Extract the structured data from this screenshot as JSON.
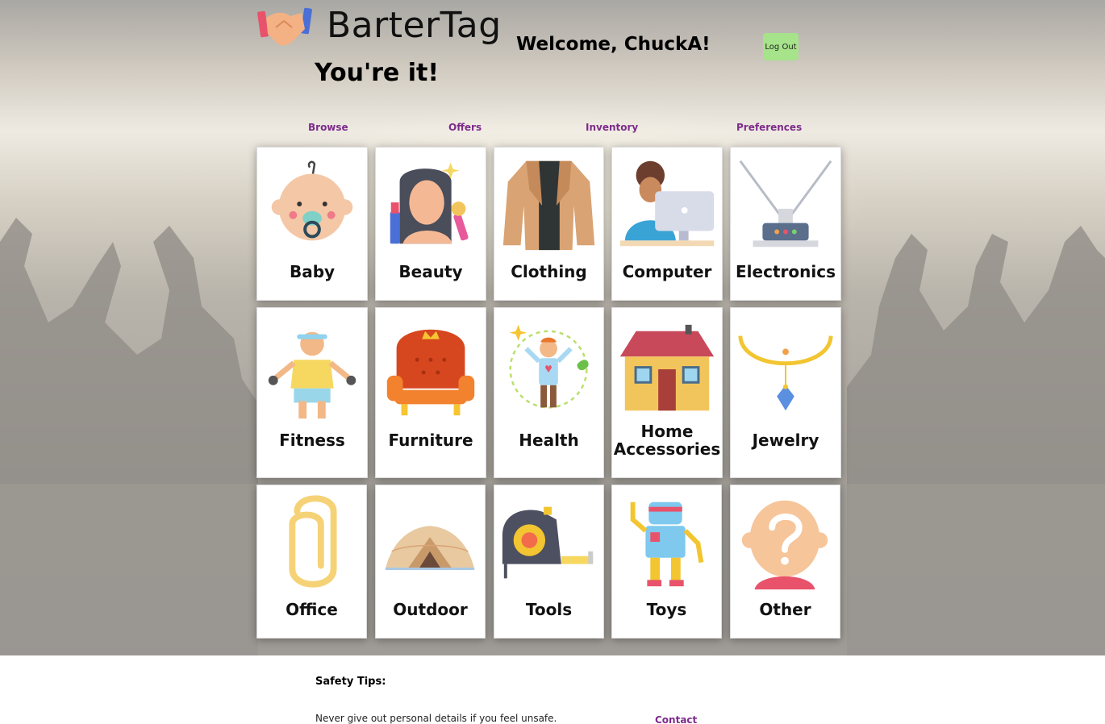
{
  "app": {
    "brand_name": "BarterTag",
    "tagline": "You're it!",
    "welcome_text": "Welcome, ChuckA!",
    "logout_label": "Log Out"
  },
  "nav": {
    "items": [
      {
        "label": "Browse"
      },
      {
        "label": "Offers"
      },
      {
        "label": "Inventory"
      },
      {
        "label": "Preferences"
      }
    ]
  },
  "categories": [
    {
      "label": "Baby",
      "icon": "baby-icon"
    },
    {
      "label": "Beauty",
      "icon": "beauty-icon"
    },
    {
      "label": "Clothing",
      "icon": "jacket-icon"
    },
    {
      "label": "Computer",
      "icon": "computer-icon"
    },
    {
      "label": "Electronics",
      "icon": "antenna-icon"
    },
    {
      "label": "Fitness",
      "icon": "fitness-icon"
    },
    {
      "label": "Furniture",
      "icon": "armchair-icon"
    },
    {
      "label": "Health",
      "icon": "health-icon"
    },
    {
      "label": "Home Accessories",
      "icon": "house-icon"
    },
    {
      "label": "Jewelry",
      "icon": "necklace-icon"
    },
    {
      "label": "Office",
      "icon": "paperclip-icon"
    },
    {
      "label": "Outdoor",
      "icon": "tent-icon"
    },
    {
      "label": "Tools",
      "icon": "tape-measure-icon"
    },
    {
      "label": "Toys",
      "icon": "robot-icon"
    },
    {
      "label": "Other",
      "icon": "question-icon"
    }
  ],
  "footer": {
    "safety_title": "Safety Tips:",
    "tip_1": "Never give out personal details if you feel unsafe.",
    "contact_label": "Contact"
  },
  "colors": {
    "nav_link": "#7d2c8b",
    "logout_bg": "#a6e38a"
  }
}
